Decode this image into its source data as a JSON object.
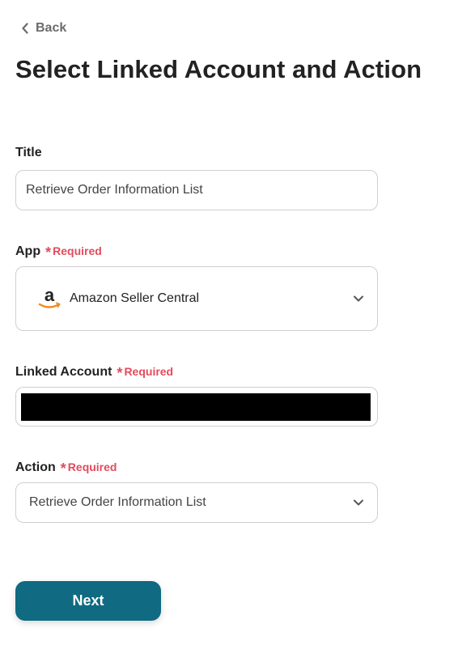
{
  "nav": {
    "back_label": "Back"
  },
  "page": {
    "title": "Select Linked Account and Action"
  },
  "form": {
    "title_field": {
      "label": "Title",
      "value": "Retrieve Order Information List"
    },
    "app_field": {
      "label": "App",
      "required_label": "Required",
      "selected_value": "Amazon Seller Central",
      "icon": "amazon-logo"
    },
    "linked_account_field": {
      "label": "Linked Account",
      "required_label": "Required"
    },
    "action_field": {
      "label": "Action",
      "required_label": "Required",
      "selected_value": "Retrieve Order Information List"
    },
    "next_label": "Next"
  },
  "colors": {
    "primary_button": "#0f6a82",
    "required": "#e24b5c",
    "border": "#cfcfcf",
    "amazon_arrow": "#f08a1c"
  }
}
